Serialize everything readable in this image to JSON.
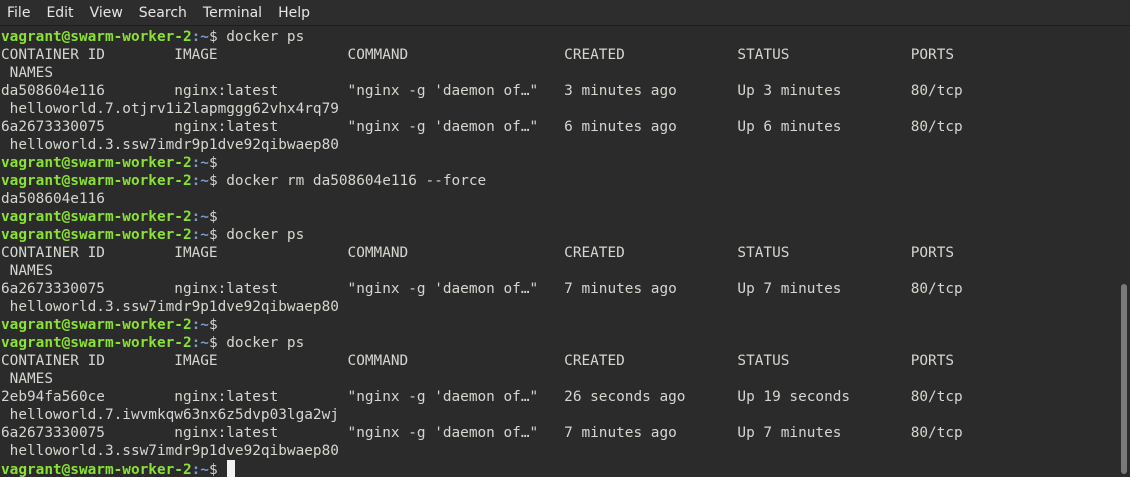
{
  "menu": {
    "file": "File",
    "edit": "Edit",
    "view": "View",
    "search": "Search",
    "terminal": "Terminal",
    "help": "Help"
  },
  "prompt": {
    "user_host": "vagrant@swarm-worker-2",
    "path": ":~",
    "symbol": "$ "
  },
  "lines": [
    {
      "type": "prompt",
      "cmd": "docker ps"
    },
    {
      "type": "out",
      "text": "CONTAINER ID        IMAGE               COMMAND                  CREATED             STATUS              PORTS"
    },
    {
      "type": "out",
      "text": " NAMES"
    },
    {
      "type": "out",
      "text": "da508604e116        nginx:latest        \"nginx -g 'daemon of…\"   3 minutes ago       Up 3 minutes        80/tcp"
    },
    {
      "type": "out",
      "text": " helloworld.7.otjrv1i2lapmggg62vhx4rq79"
    },
    {
      "type": "out",
      "text": "6a2673330075        nginx:latest        \"nginx -g 'daemon of…\"   6 minutes ago       Up 6 minutes        80/tcp"
    },
    {
      "type": "out",
      "text": " helloworld.3.ssw7imdr9p1dve92qibwaep80"
    },
    {
      "type": "prompt",
      "cmd": ""
    },
    {
      "type": "prompt",
      "cmd": "docker rm da508604e116 --force"
    },
    {
      "type": "out",
      "text": "da508604e116"
    },
    {
      "type": "prompt",
      "cmd": ""
    },
    {
      "type": "prompt",
      "cmd": "docker ps"
    },
    {
      "type": "out",
      "text": "CONTAINER ID        IMAGE               COMMAND                  CREATED             STATUS              PORTS"
    },
    {
      "type": "out",
      "text": " NAMES"
    },
    {
      "type": "out",
      "text": "6a2673330075        nginx:latest        \"nginx -g 'daemon of…\"   7 minutes ago       Up 7 minutes        80/tcp"
    },
    {
      "type": "out",
      "text": " helloworld.3.ssw7imdr9p1dve92qibwaep80"
    },
    {
      "type": "prompt",
      "cmd": ""
    },
    {
      "type": "prompt",
      "cmd": "docker ps"
    },
    {
      "type": "out",
      "text": "CONTAINER ID        IMAGE               COMMAND                  CREATED             STATUS              PORTS"
    },
    {
      "type": "out",
      "text": " NAMES"
    },
    {
      "type": "out",
      "text": "2eb94fa560ce        nginx:latest        \"nginx -g 'daemon of…\"   26 seconds ago      Up 19 seconds       80/tcp"
    },
    {
      "type": "out",
      "text": " helloworld.7.iwvmkqw63nx6z5dvp03lga2wj"
    },
    {
      "type": "out",
      "text": "6a2673330075        nginx:latest        \"nginx -g 'daemon of…\"   7 minutes ago       Up 7 minutes        80/tcp"
    },
    {
      "type": "out",
      "text": " helloworld.3.ssw7imdr9p1dve92qibwaep80"
    },
    {
      "type": "prompt",
      "cmd": "",
      "cursor": true
    }
  ],
  "colors": {
    "background": "#2b2b2b",
    "prompt_user": "#8ae234",
    "prompt_path": "#729fcf",
    "text": "#d3d7cf",
    "menubar": "#2d2d2d"
  },
  "icons": {
    "cursor": "block-cursor-icon"
  }
}
